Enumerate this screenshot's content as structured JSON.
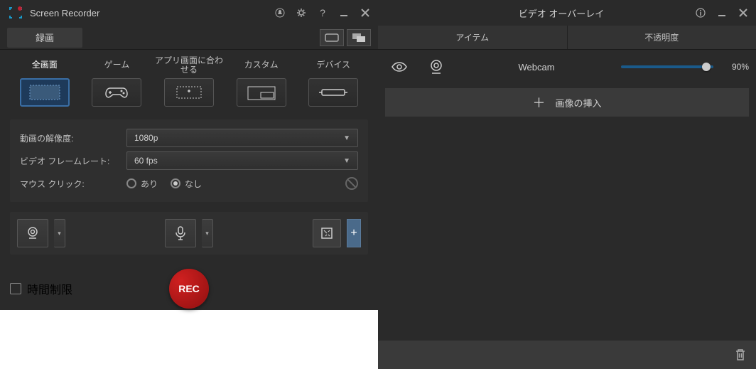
{
  "left": {
    "title": "Screen Recorder",
    "tab_record": "録画",
    "modes": [
      {
        "label": "全画面",
        "selected": true
      },
      {
        "label": "ゲーム",
        "selected": false
      },
      {
        "label": "アプリ画面に合わせる",
        "selected": false
      },
      {
        "label": "カスタム",
        "selected": false
      },
      {
        "label": "デバイス",
        "selected": false
      }
    ],
    "settings": {
      "resolution_label": "動画の解像度:",
      "resolution_value": "1080p",
      "framerate_label": "ビデオ フレームレート:",
      "framerate_value": "60 fps",
      "mouseclick_label": "マウス クリック:",
      "mouseclick_yes": "あり",
      "mouseclick_no": "なし",
      "mouseclick_selected": "no"
    },
    "time_limit_label": "時間制限",
    "rec_label": "REC"
  },
  "right": {
    "title": "ビデオ オーバーレイ",
    "col_item": "アイテム",
    "col_opacity": "不透明度",
    "items": [
      {
        "name": "Webcam",
        "opacity": 90
      }
    ],
    "insert_image": "画像の挿入"
  }
}
